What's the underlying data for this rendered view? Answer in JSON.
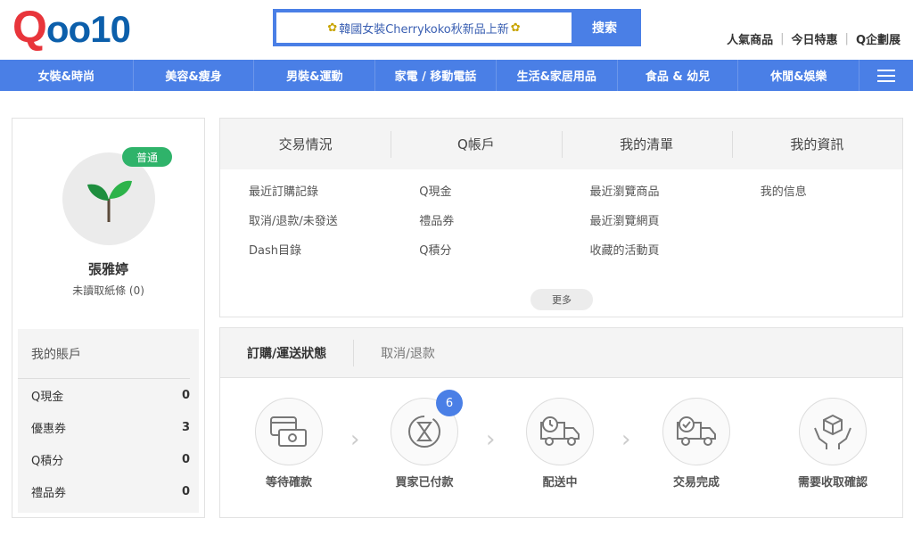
{
  "logo": {
    "q": "Q",
    "rest": "oo10"
  },
  "search": {
    "value": "韓國女裝Cherrykoko秋新品上新",
    "button": "搜索",
    "decor_icon": "bee-icon"
  },
  "toplinks": [
    "人氣商品",
    "今日特惠",
    "Q企劃展"
  ],
  "nav": [
    "女裝&時尚",
    "美容&瘦身",
    "男裝&運動",
    "家電 / 移動電話",
    "生活&家居用品",
    "食品 & 幼兒",
    "休閒&娛樂"
  ],
  "profile": {
    "badge": "普通",
    "name": "張雅婷",
    "unread": "未讀取紙條 (0)"
  },
  "account": {
    "title": "我的賬戶",
    "rows": [
      {
        "label": "Q現金",
        "value": "0"
      },
      {
        "label": "優惠券",
        "value": "3"
      },
      {
        "label": "Q積分",
        "value": "0"
      },
      {
        "label": "禮品券",
        "value": "0"
      }
    ]
  },
  "menu": {
    "headers": [
      "交易情況",
      "Q帳戶",
      "我的清單",
      "我的資訊"
    ],
    "cols": [
      [
        "最近訂購記錄",
        "取消/退款/未發送",
        "Dash目錄"
      ],
      [
        "Q現金",
        "禮品券",
        "Q積分"
      ],
      [
        "最近瀏覽商品",
        "最近瀏覽網頁",
        "收藏的活動頁"
      ],
      [
        "我的信息"
      ]
    ],
    "more": "更多"
  },
  "orders": {
    "tabs": [
      "訂購/運送狀態",
      "取消/退款"
    ],
    "steps": [
      {
        "label": "等待確款",
        "icon": "payment-card-icon"
      },
      {
        "label": "買家已付款",
        "icon": "hourglass-icon",
        "count": "6"
      },
      {
        "label": "配送中",
        "icon": "delivery-truck-icon"
      },
      {
        "label": "交易完成",
        "icon": "truck-check-icon"
      },
      {
        "label": "需要收取確認",
        "icon": "box-hands-icon"
      }
    ]
  },
  "colors": {
    "brand_blue": "#4a7fe6",
    "badge_green": "#2fb36a",
    "logo_red": "#e8353b"
  }
}
